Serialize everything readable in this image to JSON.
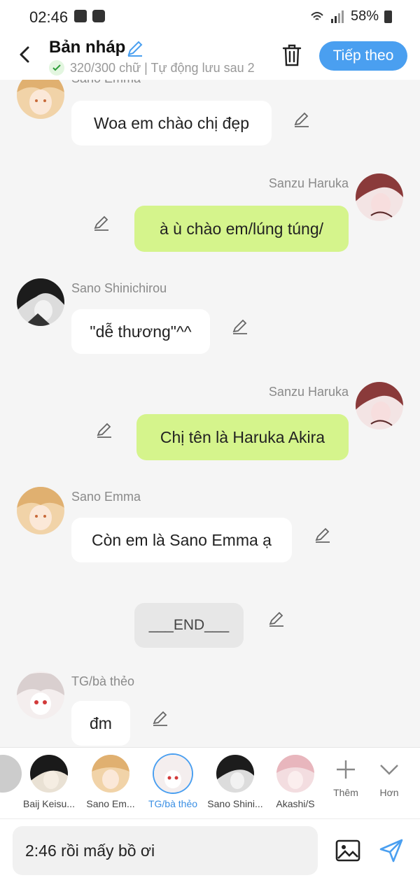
{
  "status_bar": {
    "time": "02:46",
    "battery": "58%"
  },
  "header": {
    "title": "Bản nháp",
    "subtitle": "320/300 chữ | Tự động lưu sau 2",
    "next_label": "Tiếp theo"
  },
  "messages": [
    {
      "sender": "Sano Emma",
      "text": "Woa em chào chị đẹp"
    },
    {
      "sender": "Sanzu Haruka",
      "text": "à ù chào em/lúng túng/"
    },
    {
      "sender": "Sano Shinichirou",
      "text": "\"dễ thương\"^^"
    },
    {
      "sender": "Sanzu Haruka",
      "text": "Chị tên là Haruka Akira"
    },
    {
      "sender": "Sano Emma",
      "text": "Còn em là Sano Emma ạ"
    },
    {
      "sender": "",
      "text": "___END___"
    },
    {
      "sender": "TG/bà thẻo",
      "text": "đm"
    }
  ],
  "characters": [
    {
      "name": "Baij Keisu..."
    },
    {
      "name": "Sano Em..."
    },
    {
      "name": "TG/bà thẻo",
      "selected": true
    },
    {
      "name": "Sano Shini..."
    },
    {
      "name": "Akashi/S"
    }
  ],
  "tools": {
    "more_label": "Thêm",
    "expand_label": "Hơn"
  },
  "composer": {
    "value": "2:46 rồi mấy bồ ơi"
  },
  "colors": {
    "accent": "#4a9ff0",
    "bubble_right": "#d5f48c",
    "bubble_left": "#ffffff"
  },
  "icons": [
    "back-icon",
    "edit-icon",
    "check-icon",
    "trash-icon",
    "plus-icon",
    "chevron-down-icon",
    "image-icon",
    "send-icon"
  ]
}
